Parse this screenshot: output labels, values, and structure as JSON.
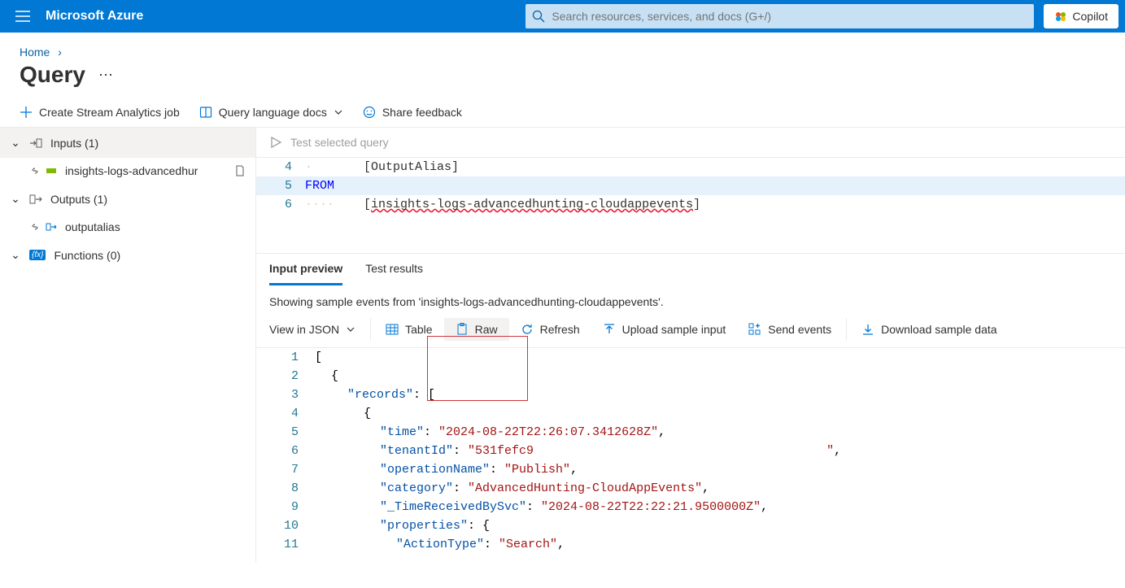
{
  "brand": "Microsoft Azure",
  "search_placeholder": "Search resources, services, and docs (G+/)",
  "copilot_label": "Copilot",
  "breadcrumb": {
    "home": "Home"
  },
  "page_title": "Query",
  "toolbar": {
    "create_job": "Create Stream Analytics job",
    "docs": "Query language docs",
    "feedback": "Share feedback"
  },
  "sidebar": {
    "inputs_label": "Inputs (1)",
    "input_item": "insights-logs-advancedhur",
    "outputs_label": "Outputs (1)",
    "output_item": "outputalias",
    "functions_label": "Functions (0)"
  },
  "editor": {
    "test_label": "Test selected query",
    "lines": {
      "l4": "    [OutputAlias]",
      "l5_kw": "FROM",
      "l6_pre": "    [",
      "l6_val": "insights-logs-advancedhunting-cloudappevents",
      "l6_post": "]"
    }
  },
  "preview": {
    "tab_input": "Input preview",
    "tab_results": "Test results",
    "showing_msg": "Showing sample events from 'insights-logs-advancedhunting-cloudappevents'.",
    "view_in_json": "View in JSON",
    "table": "Table",
    "raw": "Raw",
    "refresh": "Refresh",
    "upload": "Upload sample input",
    "send": "Send events",
    "download": "Download sample data"
  },
  "json_lines": {
    "k_records": "\"records\"",
    "k_time": "\"time\"",
    "v_time": "\"2024-08-22T22:26:07.3412628Z\"",
    "k_tenant": "\"tenantId\"",
    "v_tenant": "\"531fefc9                                        \"",
    "k_op": "\"operationName\"",
    "v_op": "\"Publish\"",
    "k_cat": "\"category\"",
    "v_cat": "\"AdvancedHunting-CloudAppEvents\"",
    "k_trcv": "\"_TimeReceivedBySvc\"",
    "v_trcv": "\"2024-08-22T22:22:21.9500000Z\"",
    "k_props": "\"properties\"",
    "v_propsopen": "{",
    "k_action": "\"ActionType\"",
    "v_action": "\"Search\""
  }
}
